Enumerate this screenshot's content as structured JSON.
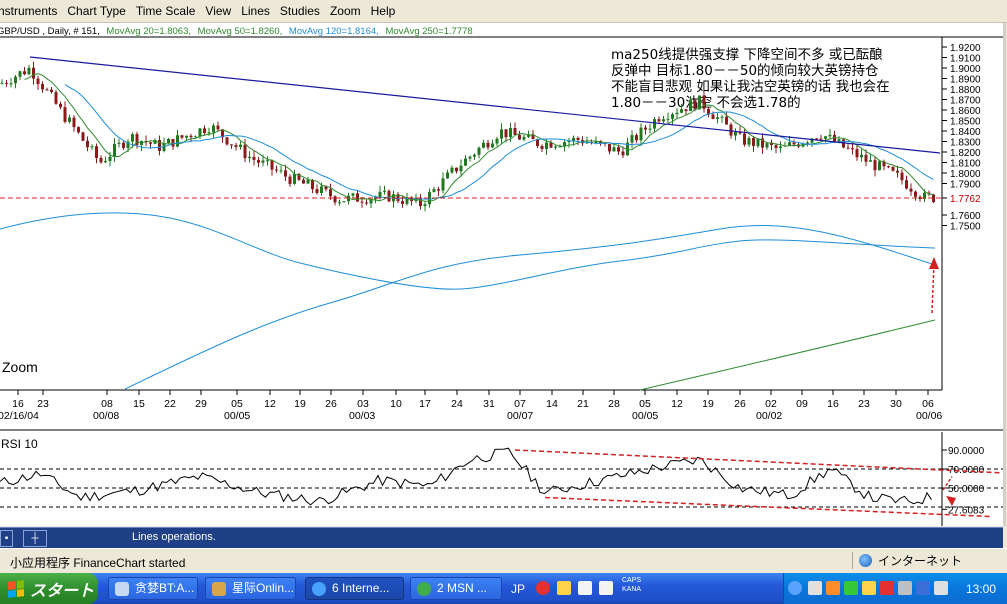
{
  "menu": [
    "nstruments",
    "Chart Type",
    "Time Scale",
    "View",
    "Lines",
    "Studies",
    "Zoom",
    "Help"
  ],
  "chart": {
    "header": {
      "symbol": "GBP/USD , Daily, # 151,",
      "ma20": "MovAvg 20=1.8063,",
      "ma50": "MovAvg 50=1.8260,",
      "ma120": "MovAvg 120=1.8164,",
      "ma250": "MovAvg 250=1.7778"
    },
    "annotation": [
      "ma250线提供强支撑  下降空间不多   或已酝酿",
      "反弹中 目标1.80－－50的倾向较大英镑持仓",
      "不能盲目悲观  如果让我沽空英镑的话 我也会在",
      "1.80－－30沽空 不会选1.78的"
    ],
    "zoom_label": "Zoom",
    "price_ticks": [
      "1.9200",
      "1.9100",
      "1.9000",
      "1.8900",
      "1.8800",
      "1.8700",
      "1.8600",
      "1.8500",
      "1.8400",
      "1.8300",
      "1.8200",
      "1.8100",
      "1.8000",
      "1.7900",
      "1.7762",
      "1.7600",
      "1.7500"
    ],
    "date_ticks": [
      "16",
      "23",
      "08",
      "15",
      "22",
      "29",
      "05",
      "12",
      "19",
      "26",
      "03",
      "10",
      "17",
      "24",
      "31",
      "07",
      "14",
      "21",
      "28",
      "05",
      "12",
      "19",
      "26",
      "02",
      "09",
      "16",
      "23",
      "30",
      "06"
    ],
    "month_ticks": [
      "02/16/04",
      "00/08",
      "00/05",
      "00/03",
      "00/07",
      "00/05",
      "00/02",
      "00/06"
    ],
    "rsi_label": "RSI 10",
    "rsi_ticks": [
      "90.0000",
      "70.0000",
      "50.0000",
      "27.6083"
    ],
    "colors": {
      "bull": "#1f7a1f",
      "bear": "#8b1a1a",
      "ma20": "#2e8b2e",
      "ma50": "#1e8fd8",
      "ma120": "#1e8fd8",
      "ma250": "#2e8b2e",
      "trendline": "#1a1aa0",
      "support": "#d42020"
    }
  },
  "ops": {
    "message": "Lines operations."
  },
  "status": {
    "left": "小应用程序 FinanceChart started",
    "zone": "インターネット"
  },
  "taskbar": {
    "start": "スタート",
    "tasks": [
      "贪婪BT:A...",
      "星际Onlin...",
      "6 Interne...",
      "2 MSN ..."
    ],
    "lang": "JP",
    "caps": "CAPS",
    "kana": "KANA",
    "clock": "13:00"
  }
}
